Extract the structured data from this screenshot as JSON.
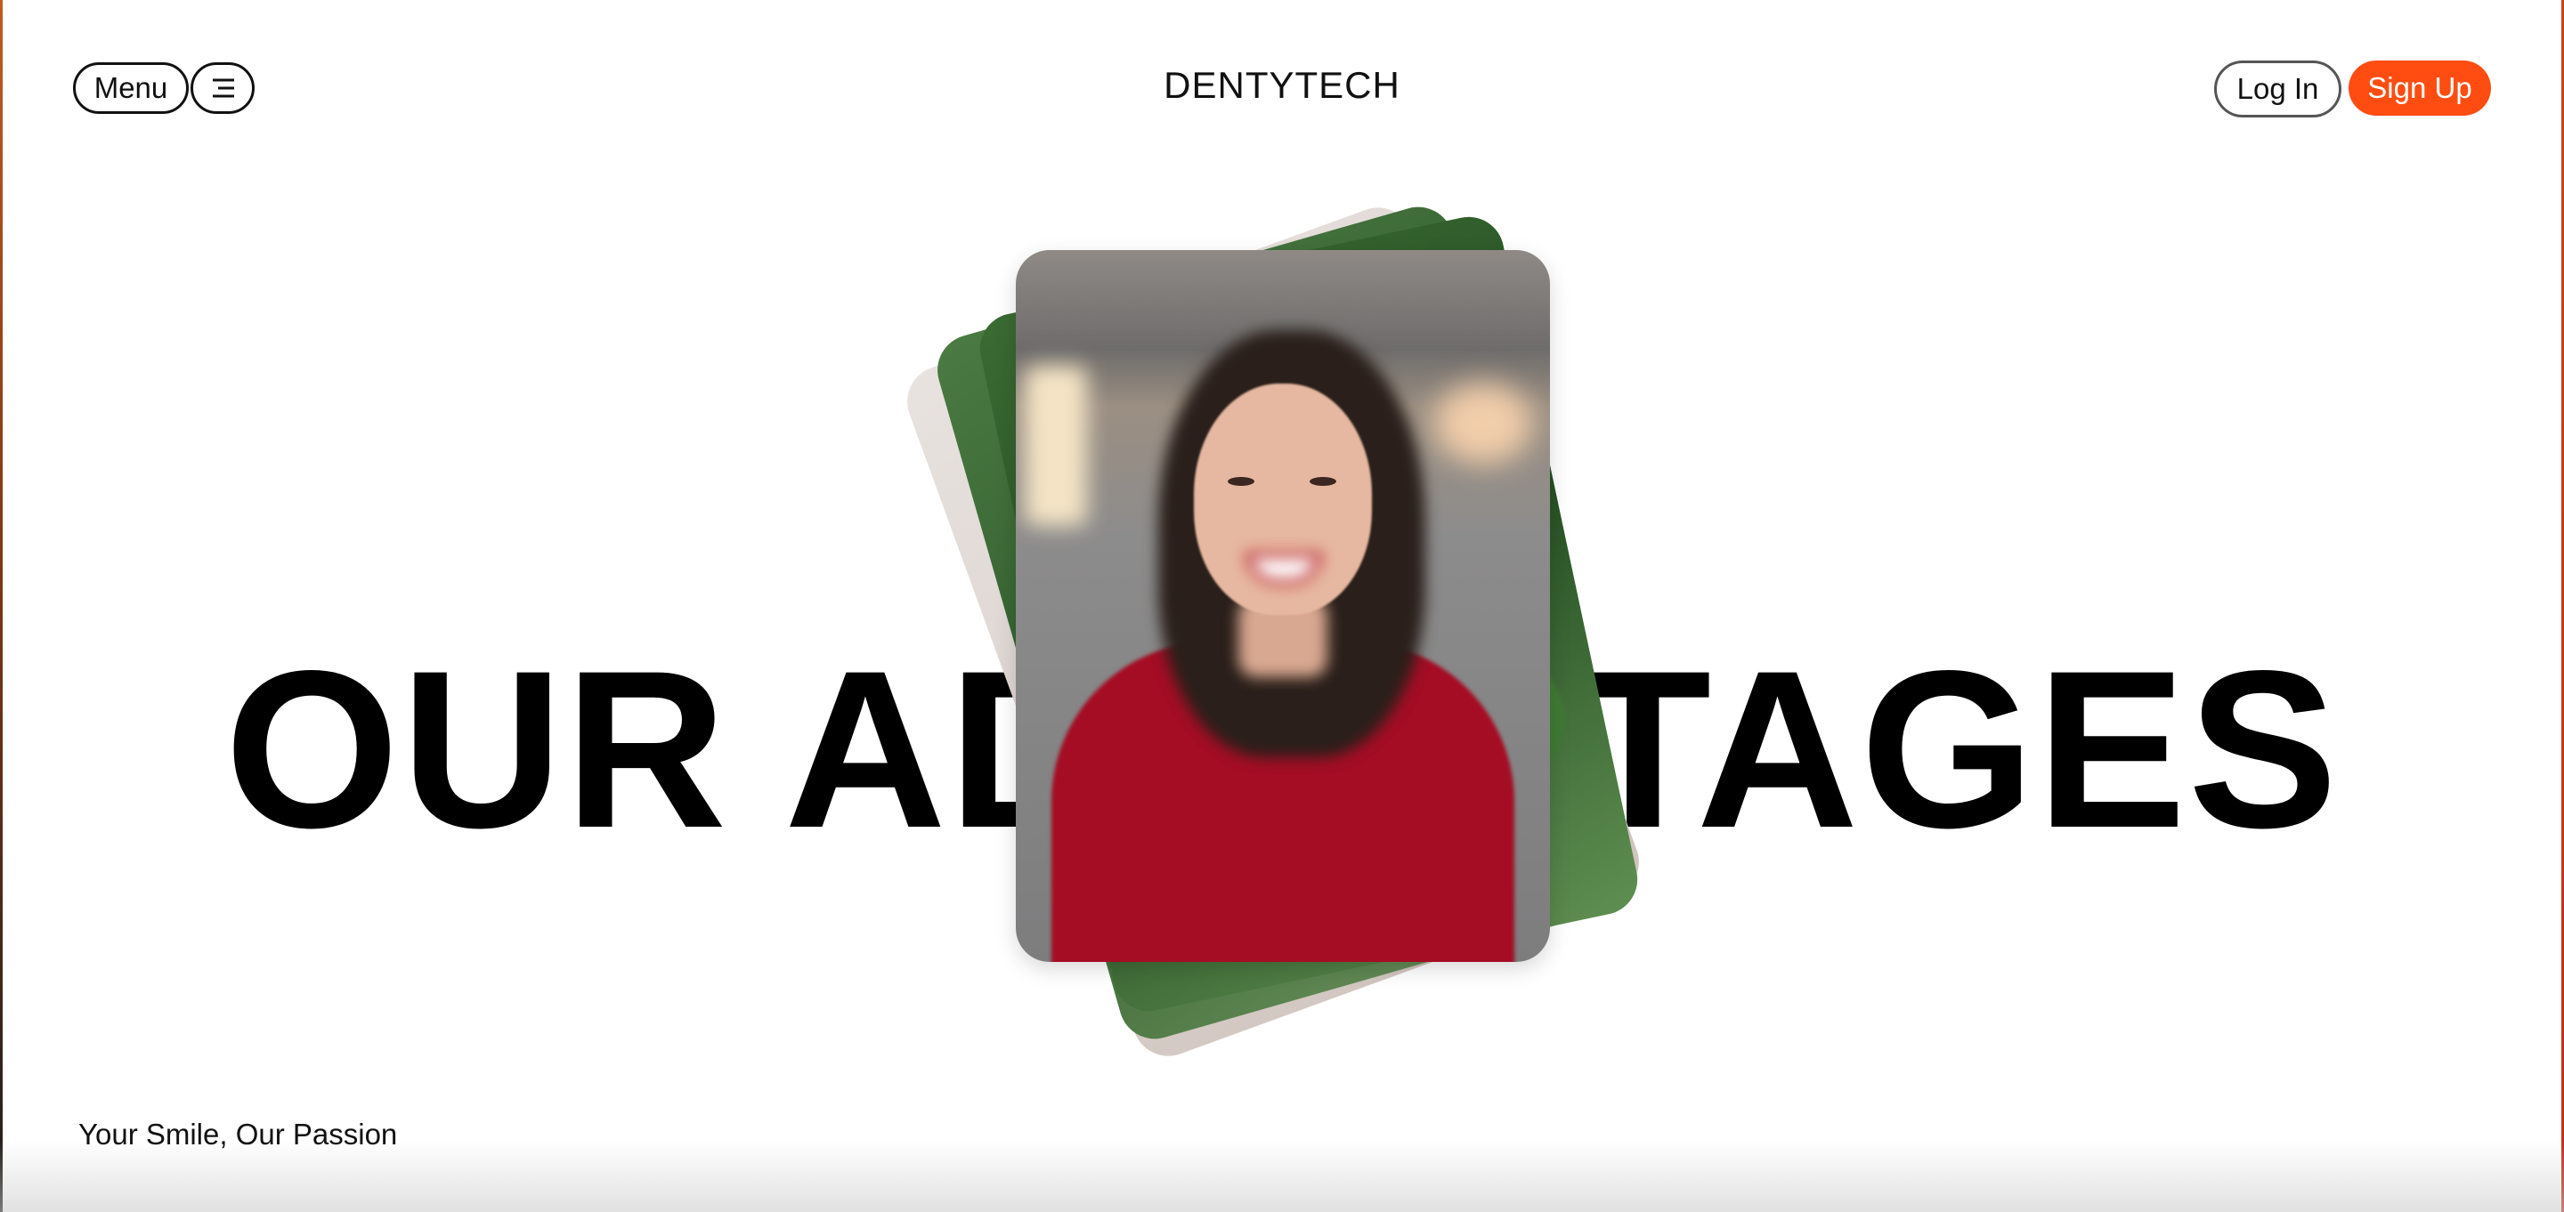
{
  "header": {
    "menu_label": "Menu",
    "menu_icon": "hamburger-menu-icon",
    "brand": "DENTYTECH",
    "login_label": "Log In",
    "signup_label": "Sign Up"
  },
  "hero": {
    "title": "OUR ADVANTAGES",
    "image_subject": "smiling woman in red sweater"
  },
  "footer": {
    "tagline": "Your Smile, Our Passion"
  },
  "colors": {
    "accent": "#ff4d12",
    "text": "#111111",
    "background": "#ffffff"
  }
}
